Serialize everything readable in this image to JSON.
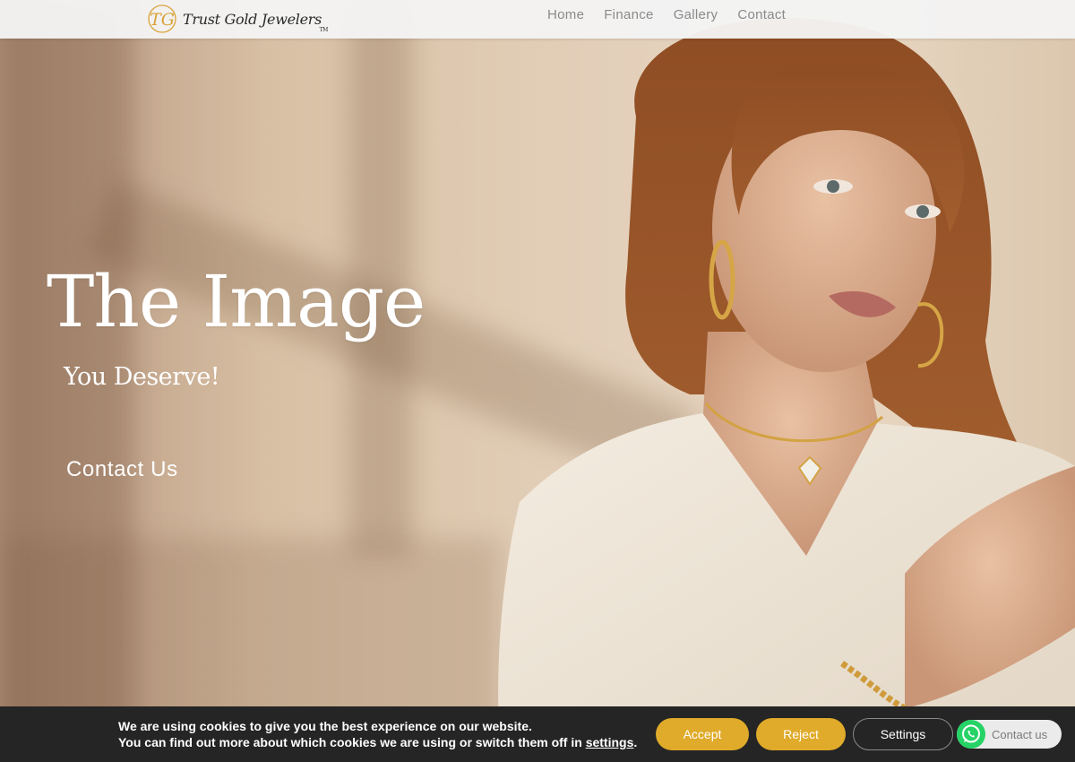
{
  "brand": {
    "monogram": "TG",
    "name": "Trust Gold Jewelers",
    "trademark": "TM"
  },
  "nav": {
    "items": [
      "Home",
      "Finance",
      "Gallery",
      "Contact"
    ]
  },
  "hero": {
    "title": "The Image",
    "subtitle": "You Deserve!",
    "cta": "Contact Us"
  },
  "cookie": {
    "line1": "We are using cookies to give you the best experience on our website.",
    "line2_prefix": "You can find out more about which cookies we are using or switch them off in ",
    "settings_link": "settings",
    "line2_suffix": ".",
    "accept": "Accept",
    "reject": "Reject",
    "settings": "Settings"
  },
  "whatsapp": {
    "label": "Contact us",
    "icon": "whatsapp-icon"
  },
  "colors": {
    "accent": "#e0ab2a",
    "nav_text": "#8a8a8a",
    "cookie_bg": "#252525",
    "whatsapp_green": "#25d366"
  }
}
